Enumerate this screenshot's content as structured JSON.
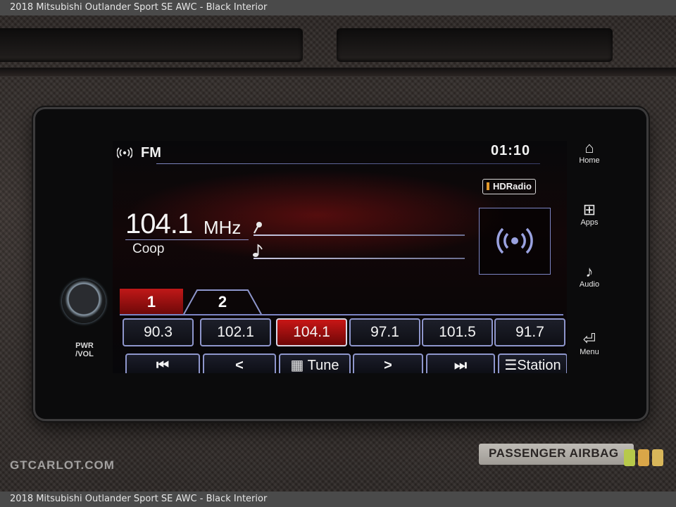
{
  "caption": "2018 Mitsubishi Outlander Sport SE AWC - Black Interior",
  "watermark": "GTCARLOT.COM",
  "unit_labels": {
    "pwr_vol": "PWR\n/VOL",
    "airbag": "PASSENGER AIRBAG"
  },
  "status_bar": {
    "band": "FM",
    "clock": "01:10",
    "hd_badge": "HDRadio"
  },
  "now_playing": {
    "frequency": "104.1",
    "unit": "MHz",
    "station_name": "Coop"
  },
  "preset_tabs": [
    "1",
    "2"
  ],
  "presets": [
    {
      "label": "90.3",
      "active": false
    },
    {
      "label": "102.1",
      "active": false
    },
    {
      "label": "104.1",
      "active": true
    },
    {
      "label": "97.1",
      "active": false
    },
    {
      "label": "101.5",
      "active": false
    },
    {
      "label": "91.7",
      "active": false
    }
  ],
  "controls": {
    "seek_back": "⏮",
    "tune_down": "<",
    "tune": "Tune",
    "tune_up": ">",
    "seek_forward": "⏭",
    "station": "Station"
  },
  "side_menu": [
    {
      "label": "Home",
      "icon": "home-icon"
    },
    {
      "label": "Apps",
      "icon": "apps-grid-icon"
    },
    {
      "label": "Audio",
      "icon": "music-note-icon"
    },
    {
      "label": "Menu",
      "icon": "menu-back-icon"
    }
  ],
  "colors": {
    "accent_red": "#c01818",
    "outline_blue": "#8e96cc",
    "hd_orange": "#e39a2a"
  }
}
